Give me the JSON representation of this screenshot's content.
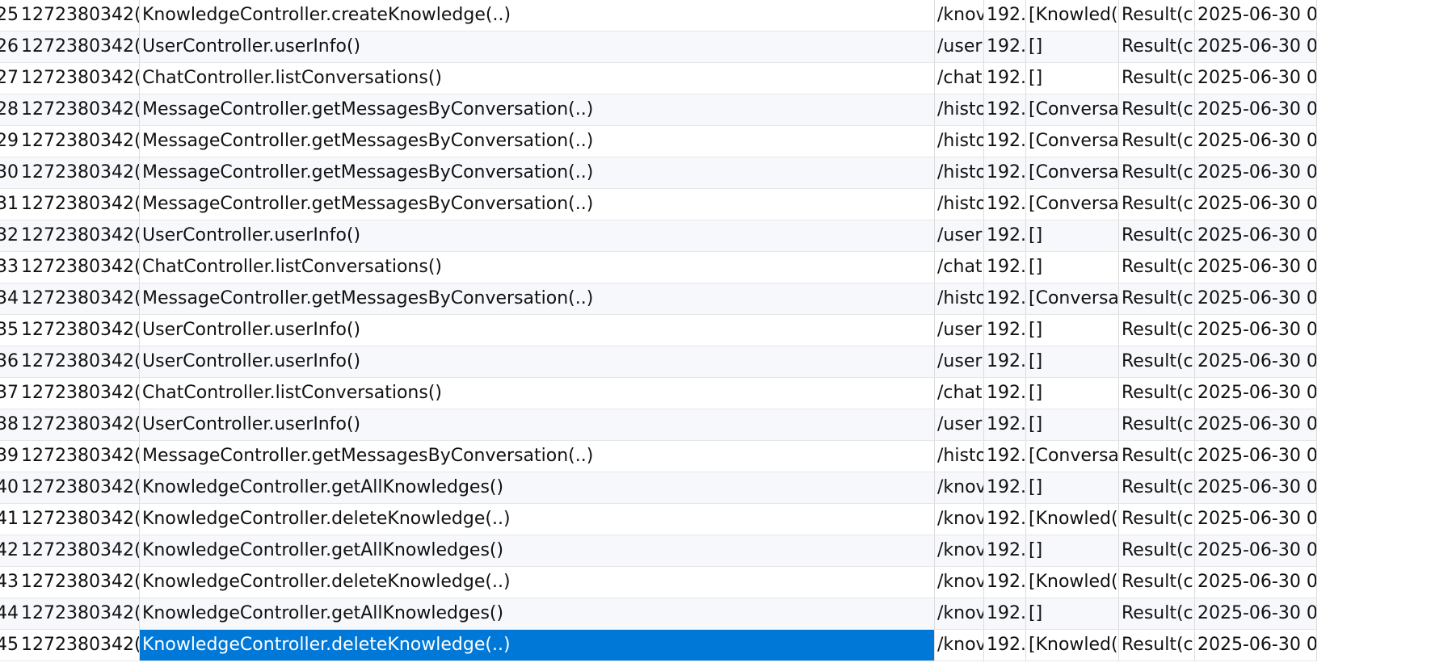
{
  "table": {
    "selected_row": 20,
    "rows": [
      {
        "num": "25",
        "trace_id": "1272380342(",
        "signature": "KnowledgeController.createKnowledge(..)",
        "url": "/knov",
        "ip": "192.",
        "args": "[Knowled(",
        "result": "Result(c",
        "time": "2025-06-30 0"
      },
      {
        "num": "26",
        "trace_id": "1272380342(",
        "signature": "UserController.userInfo()",
        "url": "/user",
        "ip": "192.",
        "args": "[]",
        "result": "Result(c",
        "time": "2025-06-30 0"
      },
      {
        "num": "27",
        "trace_id": "1272380342(",
        "signature": "ChatController.listConversations()",
        "url": "/chat",
        "ip": "192.",
        "args": "[]",
        "result": "Result(c",
        "time": "2025-06-30 0"
      },
      {
        "num": "28",
        "trace_id": "1272380342(",
        "signature": "MessageController.getMessagesByConversation(..)",
        "url": "/histo",
        "ip": "192.",
        "args": "[Conversa",
        "result": "Result(c",
        "time": "2025-06-30 0"
      },
      {
        "num": "29",
        "trace_id": "1272380342(",
        "signature": "MessageController.getMessagesByConversation(..)",
        "url": "/histo",
        "ip": "192.",
        "args": "[Conversa",
        "result": "Result(c",
        "time": "2025-06-30 0"
      },
      {
        "num": "30",
        "trace_id": "1272380342(",
        "signature": "MessageController.getMessagesByConversation(..)",
        "url": "/histo",
        "ip": "192.",
        "args": "[Conversa",
        "result": "Result(c",
        "time": "2025-06-30 0"
      },
      {
        "num": "31",
        "trace_id": "1272380342(",
        "signature": "MessageController.getMessagesByConversation(..)",
        "url": "/histo",
        "ip": "192.",
        "args": "[Conversa",
        "result": "Result(c",
        "time": "2025-06-30 0"
      },
      {
        "num": "32",
        "trace_id": "1272380342(",
        "signature": "UserController.userInfo()",
        "url": "/user",
        "ip": "192.",
        "args": "[]",
        "result": "Result(c",
        "time": "2025-06-30 0"
      },
      {
        "num": "33",
        "trace_id": "1272380342(",
        "signature": "ChatController.listConversations()",
        "url": "/chat",
        "ip": "192.",
        "args": "[]",
        "result": "Result(c",
        "time": "2025-06-30 0"
      },
      {
        "num": "34",
        "trace_id": "1272380342(",
        "signature": "MessageController.getMessagesByConversation(..)",
        "url": "/histo",
        "ip": "192.",
        "args": "[Conversa",
        "result": "Result(c",
        "time": "2025-06-30 0"
      },
      {
        "num": "35",
        "trace_id": "1272380342(",
        "signature": "UserController.userInfo()",
        "url": "/user",
        "ip": "192.",
        "args": "[]",
        "result": "Result(c",
        "time": "2025-06-30 0"
      },
      {
        "num": "36",
        "trace_id": "1272380342(",
        "signature": "UserController.userInfo()",
        "url": "/user",
        "ip": "192.",
        "args": "[]",
        "result": "Result(c",
        "time": "2025-06-30 0"
      },
      {
        "num": "37",
        "trace_id": "1272380342(",
        "signature": "ChatController.listConversations()",
        "url": "/chat",
        "ip": "192.",
        "args": "[]",
        "result": "Result(c",
        "time": "2025-06-30 0"
      },
      {
        "num": "38",
        "trace_id": "1272380342(",
        "signature": "UserController.userInfo()",
        "url": "/user",
        "ip": "192.",
        "args": "[]",
        "result": "Result(c",
        "time": "2025-06-30 0"
      },
      {
        "num": "39",
        "trace_id": "1272380342(",
        "signature": "MessageController.getMessagesByConversation(..)",
        "url": "/histo",
        "ip": "192.",
        "args": "[Conversa",
        "result": "Result(c",
        "time": "2025-06-30 0"
      },
      {
        "num": "40",
        "trace_id": "1272380342(",
        "signature": "KnowledgeController.getAllKnowledges()",
        "url": "/knov",
        "ip": "192.",
        "args": "[]",
        "result": "Result(c",
        "time": "2025-06-30 0"
      },
      {
        "num": "41",
        "trace_id": "1272380342(",
        "signature": "KnowledgeController.deleteKnowledge(..)",
        "url": "/knov",
        "ip": "192.",
        "args": "[Knowled(",
        "result": "Result(c",
        "time": "2025-06-30 0"
      },
      {
        "num": "42",
        "trace_id": "1272380342(",
        "signature": "KnowledgeController.getAllKnowledges()",
        "url": "/knov",
        "ip": "192.",
        "args": "[]",
        "result": "Result(c",
        "time": "2025-06-30 0"
      },
      {
        "num": "43",
        "trace_id": "1272380342(",
        "signature": "KnowledgeController.deleteKnowledge(..)",
        "url": "/knov",
        "ip": "192.",
        "args": "[Knowled(",
        "result": "Result(c",
        "time": "2025-06-30 0"
      },
      {
        "num": "44",
        "trace_id": "1272380342(",
        "signature": "KnowledgeController.getAllKnowledges()",
        "url": "/knov",
        "ip": "192.",
        "args": "[]",
        "result": "Result(c",
        "time": "2025-06-30 0"
      },
      {
        "num": "45",
        "trace_id": "1272380342(",
        "signature": "KnowledgeController.deleteKnowledge(..)",
        "url": "/knov",
        "ip": "192.",
        "args": "[Knowled(",
        "result": "Result(c",
        "time": "2025-06-30 0"
      }
    ]
  },
  "colors": {
    "selection": "#0078d7",
    "row_alt": "#f6f8fb",
    "grid_line": "#dcdcdc"
  }
}
